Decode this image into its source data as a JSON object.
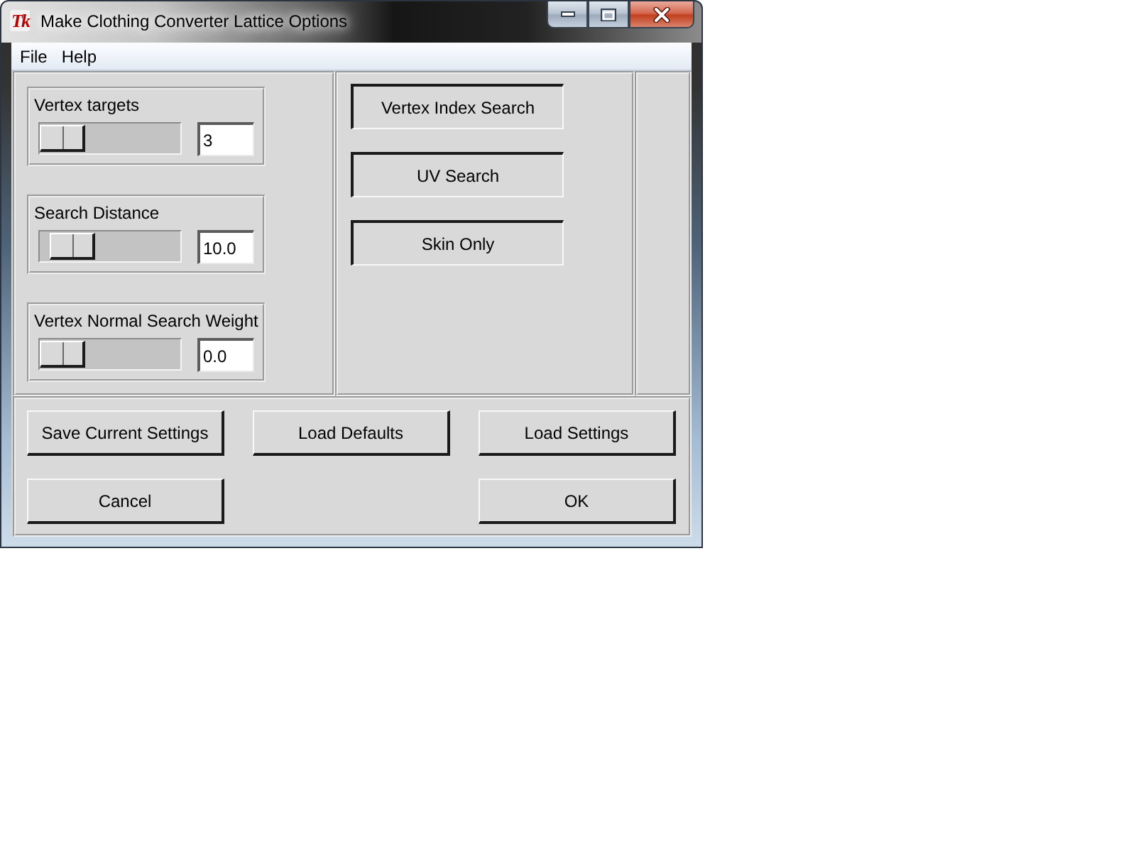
{
  "window": {
    "logo": "Tk",
    "title": "Make Clothing Converter Lattice Options"
  },
  "menu": [
    "File",
    "Help"
  ],
  "sliders": [
    {
      "label": "Vertex targets",
      "level": 0,
      "value": "3"
    },
    {
      "label": "Search Distance",
      "level": 0.11,
      "value": "10.0"
    },
    {
      "label": "Vertex Normal Search Weight",
      "level": 0,
      "value": "0.0"
    }
  ],
  "toggles": [
    {
      "label": "Vertex Index Search",
      "selected": true
    },
    {
      "label": "UV Search",
      "selected": true
    },
    {
      "label": "Skin Only",
      "selected": true
    }
  ],
  "action_buttons": [
    "Save Current Settings",
    "Load Defaults",
    "Load Settings"
  ],
  "dialog_buttons": [
    {
      "label": "Cancel",
      "kind": "cancel"
    },
    {
      "label": "OK",
      "kind": "ok"
    }
  ]
}
